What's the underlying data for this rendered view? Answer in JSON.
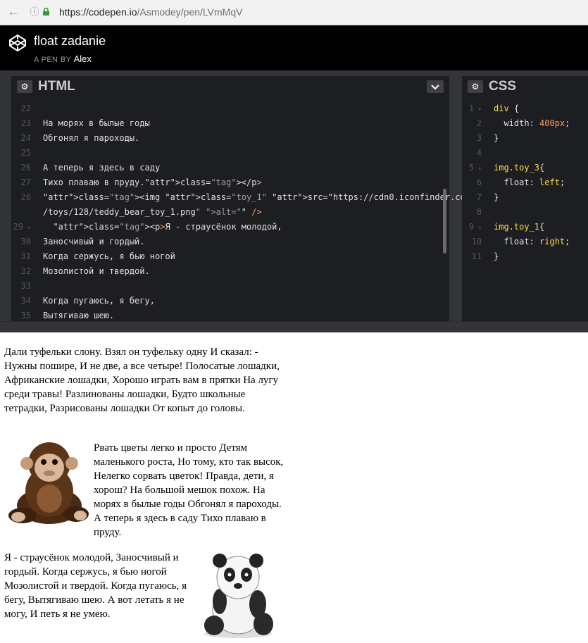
{
  "browser": {
    "url_host": "https://codepen.io",
    "url_path": "/Asmodey/pen/LVmMqV"
  },
  "pen": {
    "title": "float zadanie",
    "by_label": "A PEN BY",
    "author": "Alex"
  },
  "html_panel": {
    "title": "HTML",
    "lines": [
      {
        "n": "22",
        "t": ""
      },
      {
        "n": "23",
        "t": "На морях в былые годы"
      },
      {
        "n": "24",
        "t": "Обгонял я пароходы."
      },
      {
        "n": "25",
        "t": ""
      },
      {
        "n": "26",
        "t": "А теперь я здесь в саду"
      },
      {
        "n": "27",
        "t": "Тихо плаваю в пруду.</p>"
      },
      {
        "n": "28",
        "t": "<img class=\"toy_1\" src=\"https://cdn0.iconfinder.com/data/icons"
      },
      {
        "n": "",
        "t": "/toys/128/teddy_bear_toy_1.png\" alt=\"\" />"
      },
      {
        "n": "29",
        "t": "  <p>Я - страусёнок молодой,"
      },
      {
        "n": "30",
        "t": "Заносчивый и гордый."
      },
      {
        "n": "31",
        "t": "Когда сержусь, я бью ногой"
      },
      {
        "n": "32",
        "t": "Мозолистой и твердой."
      },
      {
        "n": "33",
        "t": ""
      },
      {
        "n": "34",
        "t": "Когда пугаюсь, я бегу,"
      },
      {
        "n": "35",
        "t": "Вытягиваю шею."
      }
    ]
  },
  "css_panel": {
    "title": "CSS",
    "lines": [
      {
        "n": "1",
        "t": "div {"
      },
      {
        "n": "2",
        "t": "  width: 400px;"
      },
      {
        "n": "3",
        "t": "}"
      },
      {
        "n": "4",
        "t": ""
      },
      {
        "n": "5",
        "t": "img.toy_3{"
      },
      {
        "n": "6",
        "t": "  float: left;"
      },
      {
        "n": "7",
        "t": "}"
      },
      {
        "n": "8",
        "t": ""
      },
      {
        "n": "9",
        "t": "img.toy_1{"
      },
      {
        "n": "10",
        "t": "  float: right;"
      },
      {
        "n": "11",
        "t": "}"
      }
    ]
  },
  "preview": {
    "paragraph1": "Дали туфельки слону. Взял он туфельку одну И сказал: - Нужны пошире, И не две, а все четыре! Полосатые лошадки, Африканские лошадки, Хорошо играть вам в прятки На лугу среди травы! Разлинованы лошадки, Будто школьные тетрадки, Разрисованы лошадки От копыт до головы.",
    "paragraph2": "Рвать цветы легко и просто Детям маленького роста, Но тому, кто так высок, Нелегко сорвать цветок! Правда, дети, я хорош? На большой мешок похож. На морях в былые годы Обгонял я пароходы. А теперь я здесь в саду Тихо плаваю в пруду.",
    "paragraph3": "Я - страусёнок молодой, Заносчивый и гордый. Когда сержусь, я бью ногой Мозолистой и твердой. Когда пугаюсь, я бегу, Вытягиваю шею. А вот летать я не могу, И петь я не умею."
  },
  "icons": {
    "back": "back-arrow-icon",
    "info": "info-icon",
    "lock": "lock-icon",
    "logo": "codepen-logo-icon",
    "gear": "gear-icon",
    "chevron": "chevron-down-icon"
  },
  "colors": {
    "editor_bg": "#1d1e22",
    "tag": "#ff9d5c",
    "attr": "#ffdd40"
  }
}
